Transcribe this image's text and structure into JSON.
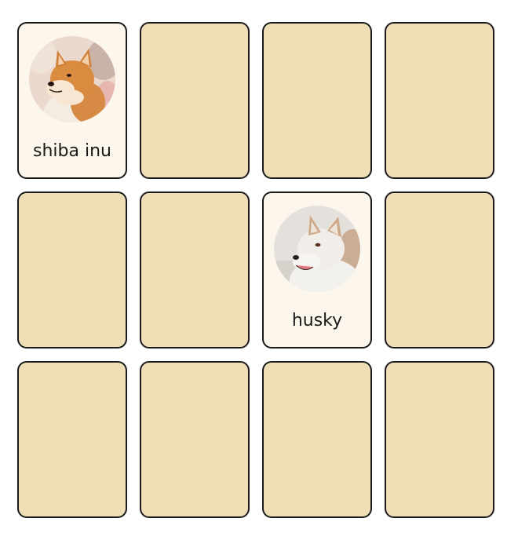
{
  "board": {
    "rows": 3,
    "columns": 4,
    "cards": [
      {
        "state": "face-up",
        "label": "shiba inu",
        "icon": "shiba-inu-photo"
      },
      {
        "state": "face-down",
        "label": "",
        "icon": ""
      },
      {
        "state": "face-down",
        "label": "",
        "icon": ""
      },
      {
        "state": "face-down",
        "label": "",
        "icon": ""
      },
      {
        "state": "face-down",
        "label": "",
        "icon": ""
      },
      {
        "state": "face-down",
        "label": "",
        "icon": ""
      },
      {
        "state": "face-up",
        "label": "husky",
        "icon": "husky-photo"
      },
      {
        "state": "face-down",
        "label": "",
        "icon": ""
      },
      {
        "state": "face-down",
        "label": "",
        "icon": ""
      },
      {
        "state": "face-down",
        "label": "",
        "icon": ""
      },
      {
        "state": "face-down",
        "label": "",
        "icon": ""
      },
      {
        "state": "face-down",
        "label": "",
        "icon": ""
      }
    ]
  },
  "colors": {
    "card_back": "#f0deb7",
    "card_face": "#fcf6ec",
    "card_border": "#1a1a1a",
    "label_text": "#1a1a1a"
  }
}
